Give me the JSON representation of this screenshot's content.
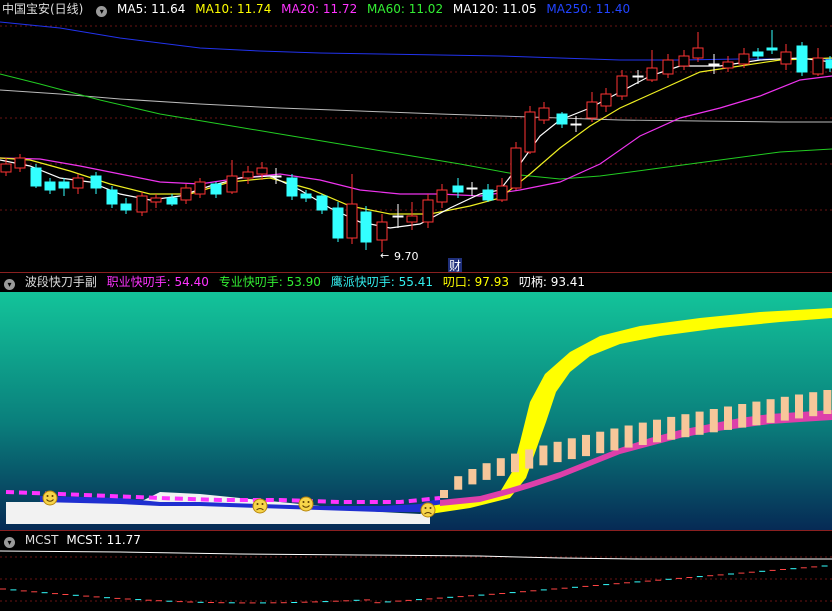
{
  "main_panel": {
    "symbol": "中国宝安(日线)",
    "ma": [
      {
        "label": "MA5: 11.64",
        "color": "#ffffff"
      },
      {
        "label": "MA10: 11.74",
        "color": "#ffff00"
      },
      {
        "label": "MA20: 11.72",
        "color": "#ff33ff"
      },
      {
        "label": "MA60: 11.02",
        "color": "#33ee33"
      },
      {
        "label": "MA120: 11.05",
        "color": "#ffffff"
      },
      {
        "label": "MA250: 11.40",
        "color": "#2244ff"
      }
    ],
    "low_annotation": "9.70",
    "finance_badge": "财"
  },
  "indicator_panel": {
    "title": "波段快刀手副",
    "items": [
      {
        "label": "职业快叨手: 54.40",
        "color": "#ff33ff"
      },
      {
        "label": "专业快叨手: 53.90",
        "color": "#33ee33"
      },
      {
        "label": "鹰派快叨手: 55.41",
        "color": "#33eeee"
      },
      {
        "label": "叨口: 97.93",
        "color": "#ffff00"
      },
      {
        "label": "叨柄: 93.41",
        "color": "#ffffff"
      }
    ]
  },
  "mcst_panel": {
    "title": "MCST",
    "value_label": "MCST: 11.77"
  },
  "colors": {
    "up": "#ff3333",
    "down": "#33ffff",
    "bg": "#000000",
    "separator": "#8a2020"
  },
  "icons": [
    "collapse-arrow-icon",
    "smiley-face-icon",
    "frown-face-icon"
  ]
}
